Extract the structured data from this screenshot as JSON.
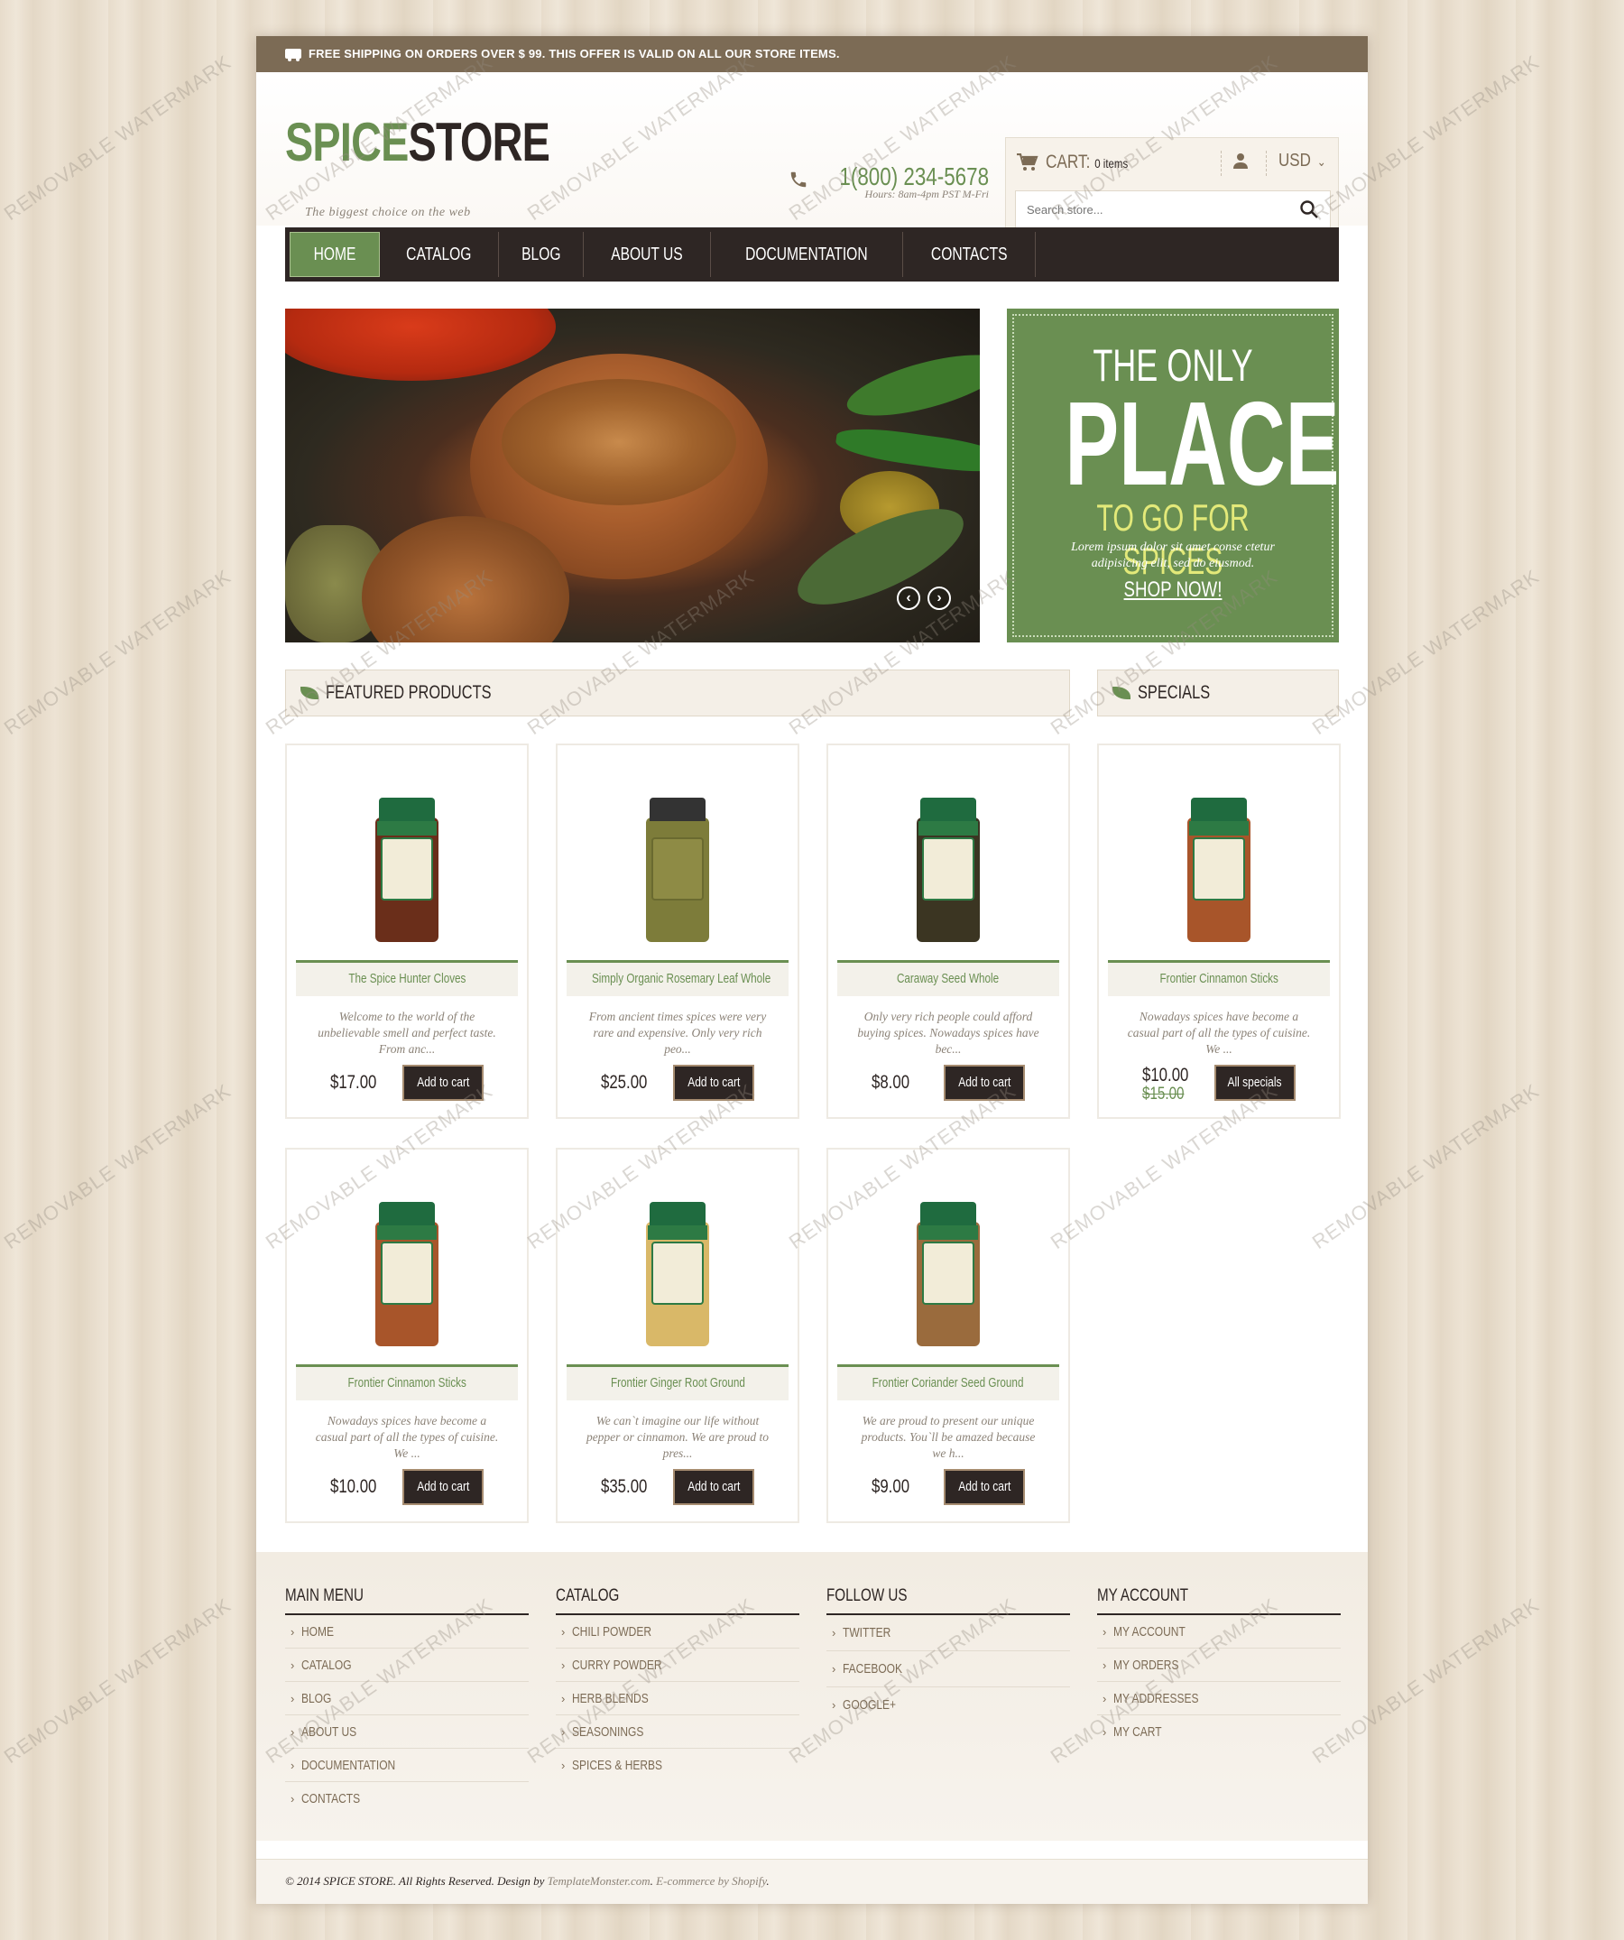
{
  "topbar": {
    "bold": "FREE SHIPPING",
    "rest": " ON ORDERS OVER $ 99. THIS OFFER IS VALID ON ALL OUR STORE ITEMS.",
    "icon": "truck-icon"
  },
  "header": {
    "logo_green": "SPICE",
    "logo_dark": "STORE",
    "tagline": "The biggest choice on the web",
    "phone": "1(800) 234-5678",
    "hours": "Hours: 8am-4pm PST M-Fri",
    "cart_label": "CART:",
    "cart_count": "0 items",
    "currency": "USD",
    "search_placeholder": "Search store..."
  },
  "nav": {
    "items": [
      "HOME",
      "CATALOG",
      "BLOG",
      "ABOUT US",
      "DOCUMENTATION",
      "CONTACTS"
    ],
    "active": "HOME"
  },
  "promo": {
    "line1": "THE ONLY",
    "line2": "PLACE",
    "line3": "TO GO FOR SPICES",
    "text": "Lorem ipsum dolor sit amet conse ctetur adipisicing elit, sed do eiusmod.",
    "cta": "SHOP NOW!"
  },
  "sections": {
    "featured": "FEATURED PRODUCTS",
    "specials": "SPECIALS"
  },
  "featured": [
    {
      "name": "The Spice Hunter Cloves",
      "desc": "Welcome to the world of the unbelievable smell and perfect taste. From anc...",
      "price": "$17.00",
      "button": "Add to cart",
      "jar": "#6a2e1a"
    },
    {
      "name": "Simply Organic Rosemary Leaf Whole",
      "desc": "From ancient times spices were very rare and expensive. Only very rich peo...",
      "price": "$25.00",
      "button": "Add to cart",
      "jar": "#7d7c3a"
    },
    {
      "name": "Caraway Seed Whole",
      "desc": "Only very rich people could afford buying spices. Nowadays spices have bec...",
      "price": "$8.00",
      "button": "Add to cart",
      "jar": "#3b3522"
    },
    {
      "name": "Frontier Cinnamon Sticks",
      "desc": "Nowadays spices have become a casual part of all the types of cuisine. We ...",
      "price": "$10.00",
      "button": "Add to cart",
      "jar": "#a8552a"
    },
    {
      "name": "Frontier Ginger Root Ground",
      "desc": "We can`t imagine our life without pepper or cinnamon. We are proud to pres...",
      "price": "$35.00",
      "button": "Add to cart",
      "jar": "#d9b868"
    },
    {
      "name": "Frontier Coriander Seed Ground",
      "desc": "We are proud to present our unique products. You`ll be amazed because we h...",
      "price": "$9.00",
      "button": "Add to cart",
      "jar": "#9a6b3d"
    }
  ],
  "special": {
    "name": "Frontier Cinnamon Sticks",
    "desc": "Nowadays spices have become a casual part of all the types of cuisine. We ...",
    "price": "$10.00",
    "old_price": "$15.00",
    "button": "All specials",
    "jar": "#a8552a"
  },
  "footer": {
    "main_menu": {
      "title": "MAIN MENU",
      "items": [
        "HOME",
        "CATALOG",
        "BLOG",
        "ABOUT US",
        "DOCUMENTATION",
        "CONTACTS"
      ]
    },
    "catalog": {
      "title": "CATALOG",
      "items": [
        "CHILI POWDER",
        "CURRY POWDER",
        "HERB BLENDS",
        "SEASONINGS",
        "SPICES & HERBS"
      ]
    },
    "follow": {
      "title": "FOLLOW US",
      "items": [
        "TWITTER",
        "FACEBOOK",
        "GOOGLE+"
      ]
    },
    "account": {
      "title": "MY ACCOUNT",
      "items": [
        "MY ACCOUNT",
        "MY ORDERS",
        "MY ADDRESSES",
        "MY CART"
      ]
    },
    "copyright_pre": "© 2014 SPICE STORE. All Rights Reserved. Design by ",
    "copyright_link1": "TemplateMonster.com",
    "copyright_mid": ". ",
    "copyright_link2": "E-commerce by Shopify",
    "copyright_end": "."
  },
  "watermark": "REMOVABLE WATERMARK",
  "colors": {
    "brand_green": "#6a8f52",
    "dark_brown": "#2e2624",
    "topbar": "#7c6b55"
  }
}
